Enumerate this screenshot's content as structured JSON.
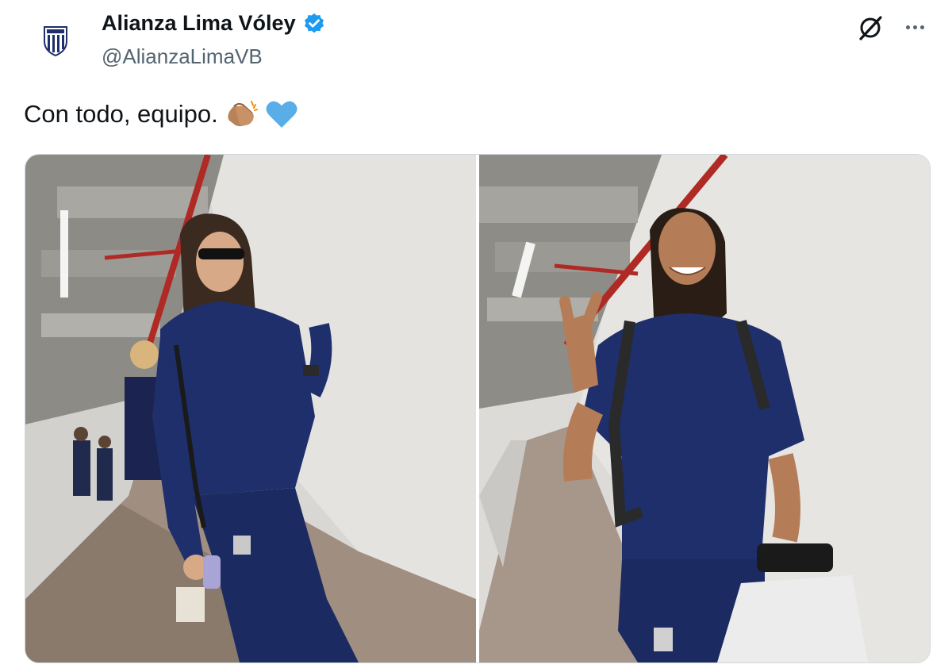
{
  "tweet": {
    "display_name": "Alianza Lima Vóley",
    "handle": "@AlianzaLimaVB",
    "text": "Con todo, equipo.",
    "emojis": [
      "clapping-hands",
      "light-blue-heart"
    ],
    "verified": true
  },
  "icons": {
    "avatar": "alianza-lima-crest-icon",
    "verified": "verified-badge-icon",
    "grok": "grok-icon",
    "more": "more-options-icon"
  },
  "media": {
    "images": [
      {
        "alt": "Jugadora con lentes de sol caminando por un pasillo"
      },
      {
        "alt": "Jugadora sonriendo haciendo el signo de la paz"
      }
    ]
  },
  "colors": {
    "verified": "#1d9bf0",
    "handle": "#536471",
    "uniform": "#1e2f6b",
    "heart": "#5aaee8",
    "clap": "#b9835a"
  }
}
